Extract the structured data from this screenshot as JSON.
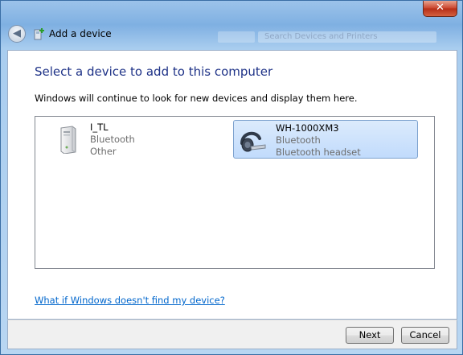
{
  "window": {
    "title": "Add a device",
    "close_label": "✕",
    "search_placeholder": "Search Devices and Printers"
  },
  "main": {
    "heading": "Select a device to add to this computer",
    "subtext": "Windows will continue to look for new devices and display them here.",
    "devices": [
      {
        "name": "I_TL",
        "type": "Bluetooth",
        "category": "Other",
        "icon": "computer-tower-icon",
        "selected": false
      },
      {
        "name": "WH-1000XM3",
        "type": "Bluetooth",
        "category": "Bluetooth headset",
        "icon": "bluetooth-headset-icon",
        "selected": true
      }
    ],
    "help_link": "What if Windows doesn't find my device?"
  },
  "footer": {
    "next_label": "Next",
    "cancel_label": "Cancel"
  },
  "colors": {
    "heading": "#1e3287",
    "link": "#0066cc",
    "selection": "#c1dbfc"
  }
}
